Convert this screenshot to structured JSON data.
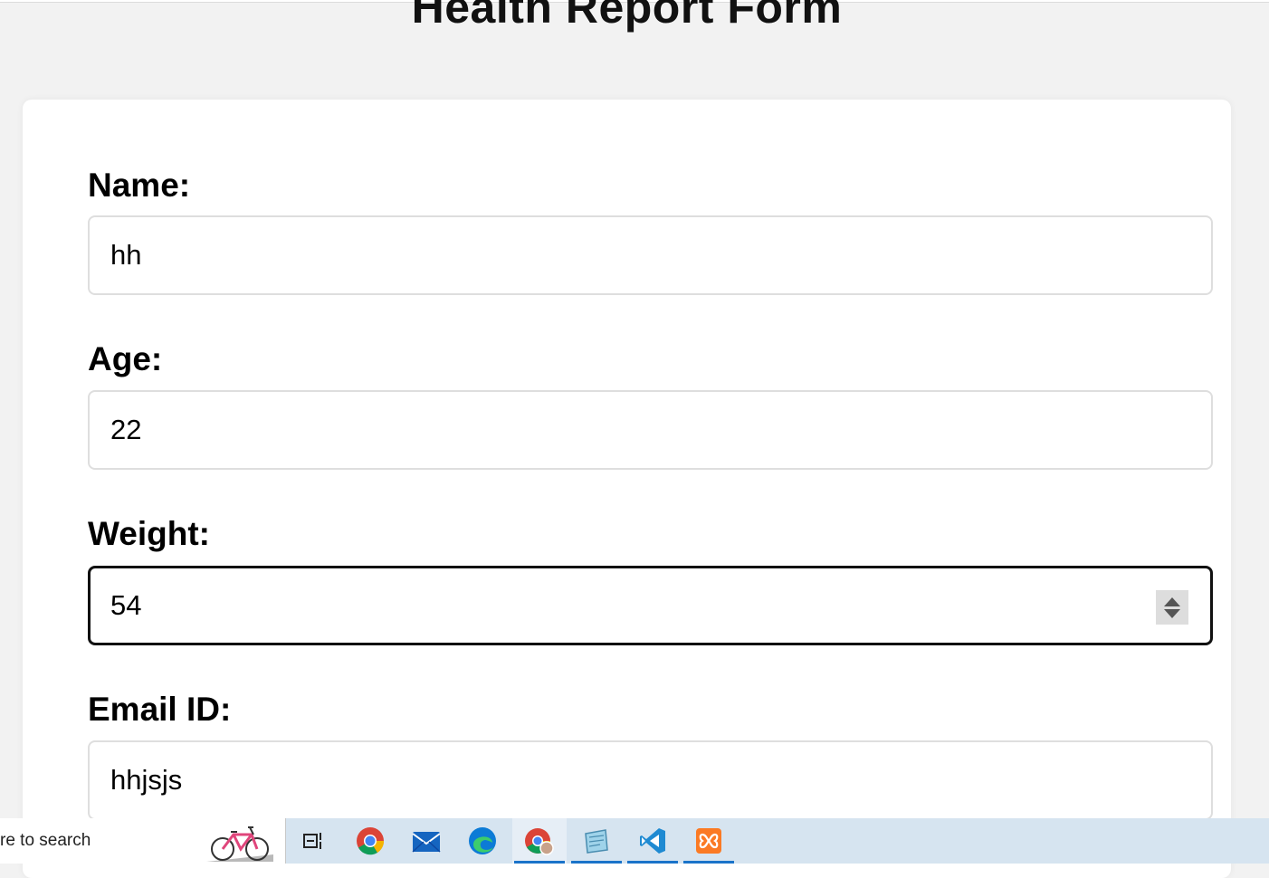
{
  "page": {
    "title": "Health Report Form"
  },
  "form": {
    "fields": [
      {
        "label": "Name:",
        "value": "hh"
      },
      {
        "label": "Age:",
        "value": "22"
      },
      {
        "label": "Weight:",
        "value": "54"
      },
      {
        "label": "Email ID:",
        "value": "hhjsjs"
      }
    ]
  },
  "taskbar": {
    "search_text": "re to search",
    "icons": [
      "task-view-icon",
      "chrome-icon",
      "mail-icon",
      "edge-icon",
      "chrome-profile-icon",
      "notepad-icon",
      "vscode-icon",
      "xampp-icon"
    ],
    "colors": {
      "accent": "#1a73c9",
      "background": "#d6e4f0"
    }
  }
}
